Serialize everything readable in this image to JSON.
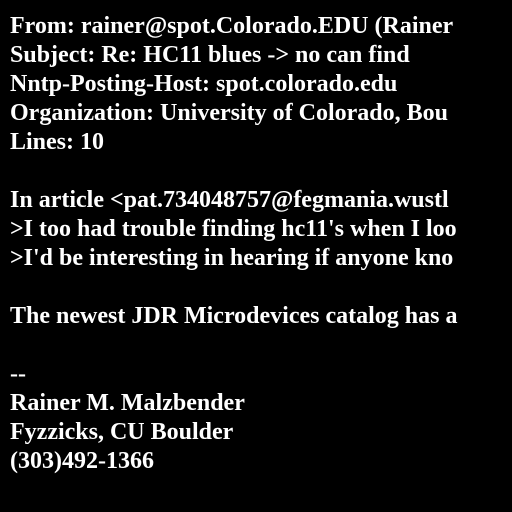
{
  "colors": {
    "background": "#000000",
    "text": "#ffffff"
  },
  "header": {
    "from": "From: rainer@spot.Colorado.EDU (Rainer",
    "subject": "Subject: Re: HC11 blues -> no can find",
    "nntp_host": "Nntp-Posting-Host: spot.colorado.edu",
    "organization": "Organization: University of Colorado, Bou",
    "lines": "Lines: 10"
  },
  "body": {
    "attribution": "In article <pat.734048757@fegmania.wustl",
    "quote_1": ">I too had trouble finding hc11's when I loo",
    "quote_2": ">I'd be interesting in hearing if anyone kno",
    "reply": "The newest JDR Microdevices catalog has a"
  },
  "signature": {
    "separator": "--",
    "name": "Rainer M. Malzbender",
    "affiliation": "Fyzzicks, CU Boulder",
    "phone": "(303)492-1366"
  }
}
